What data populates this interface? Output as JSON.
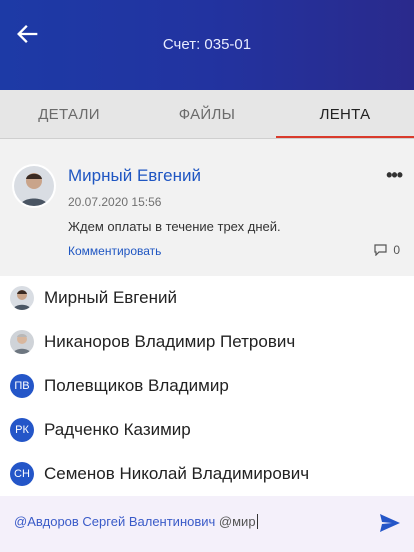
{
  "header": {
    "title": "Счет: 035-01",
    "back_icon": "arrow-left-icon"
  },
  "tabs": [
    {
      "label": "ДЕТАЛИ",
      "active": false
    },
    {
      "label": "ФАЙЛЫ",
      "active": false
    },
    {
      "label": "ЛЕНТА",
      "active": true
    }
  ],
  "post": {
    "author": "Мирный Евгений",
    "date": "20.07.2020 15:56",
    "text": "Ждем оплаты в течение трех дней.",
    "comment_label": "Комментировать",
    "comment_count": "0",
    "more_icon": "more-dots-icon"
  },
  "mentions": [
    {
      "name": "Мирный Евгений",
      "avatar": "photo"
    },
    {
      "name": "Никаноров Владимир Петрович",
      "avatar": "photo"
    },
    {
      "name": "Полевщиков Владимир",
      "initials": "ПВ"
    },
    {
      "name": "Радченко Казимир",
      "initials": "РК"
    },
    {
      "name": "Семенов Николай Владимирович",
      "initials": "СН"
    }
  ],
  "composer": {
    "mention": "@Авдоров Сергей Валентинович",
    "typed": "@мир",
    "send_icon": "send-icon"
  },
  "colors": {
    "header_start": "#1d3aa6",
    "accent_tab": "#d93a2b",
    "link": "#1f56c2",
    "initials_bg": "#2456c8"
  }
}
